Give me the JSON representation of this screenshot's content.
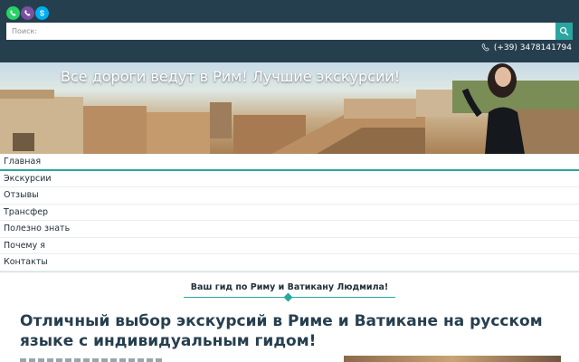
{
  "messengers": [
    {
      "icon": "whatsapp-icon",
      "color": "#25d366"
    },
    {
      "icon": "viber-icon",
      "color": "#7b519d"
    },
    {
      "icon": "skype-icon",
      "color": "#00aff0"
    }
  ],
  "search": {
    "placeholder": "Поиск:",
    "value": ""
  },
  "phone": {
    "icon": "phone-icon",
    "number": "(+39) 3478141794"
  },
  "banner": {
    "title": "Все дороги ведут в Рим! Лучшие экскурсии!"
  },
  "nav": {
    "items": [
      {
        "label": "Главная",
        "active": true
      },
      {
        "label": "Экскурсии"
      },
      {
        "label": "Отзывы"
      },
      {
        "label": "Трансфер"
      },
      {
        "label": "Полезно знать"
      },
      {
        "label": "Почему я"
      },
      {
        "label": "Контакты"
      }
    ]
  },
  "guide": {
    "label": "Ваш гид по Риму и Ватикану Людмила!"
  },
  "main": {
    "headline": "Отличный выбор экскурсий в Риме и Ватикане на русском языке с индивидуальным гидом!"
  },
  "colors": {
    "header_bg": "#263f4f",
    "accent": "#2aa6a0"
  }
}
